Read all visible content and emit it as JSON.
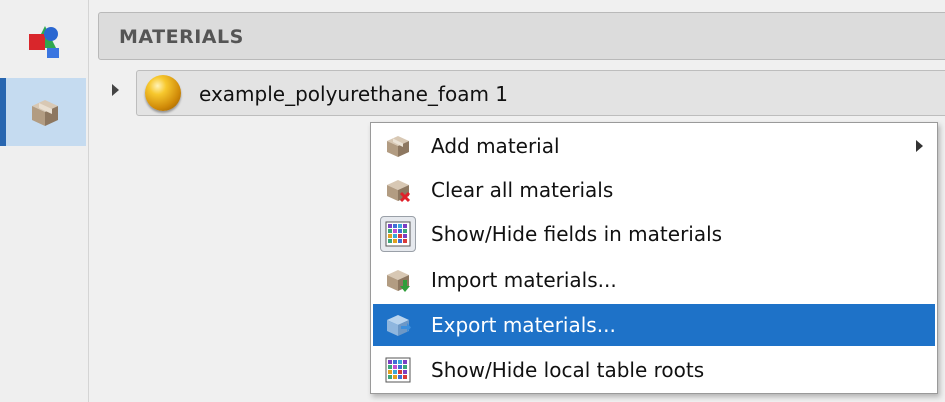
{
  "header": {
    "title": "MATERIALS"
  },
  "tree": {
    "items": [
      {
        "label": "example_polyurethane_foam 1",
        "expanded": false
      }
    ]
  },
  "context_menu": {
    "items": [
      {
        "label": "Add material",
        "icon": "box-icon",
        "has_submenu": true,
        "highlighted": false
      },
      {
        "label": "Clear all materials",
        "icon": "box-clear-icon",
        "has_submenu": false,
        "highlighted": false
      },
      {
        "label": "Show/Hide fields in materials",
        "icon": "grid-toggle-icon",
        "has_submenu": false,
        "highlighted": false,
        "checked": true
      },
      {
        "label": "Import materials...",
        "icon": "box-import-icon",
        "has_submenu": false,
        "highlighted": false
      },
      {
        "label": "Export materials...",
        "icon": "box-export-icon",
        "has_submenu": false,
        "highlighted": true
      },
      {
        "label": "Show/Hide local table roots",
        "icon": "grid-icon",
        "has_submenu": false,
        "highlighted": false
      }
    ]
  },
  "colors": {
    "highlight": "#1e72c8",
    "sidebar_active": "#c5dbf0",
    "sidebar_active_bar": "#2866b0"
  }
}
